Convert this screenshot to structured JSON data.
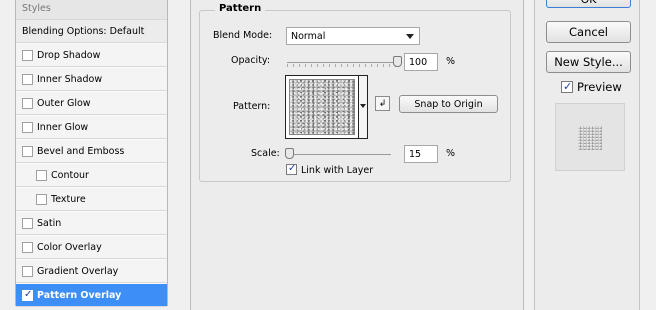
{
  "styles_panel": {
    "header": "Styles",
    "items": [
      {
        "label": "Blending Options: Default",
        "checkbox": false,
        "checked": false,
        "indent": false,
        "selected": false
      },
      {
        "label": "Drop Shadow",
        "checkbox": true,
        "checked": false,
        "indent": false,
        "selected": false
      },
      {
        "label": "Inner Shadow",
        "checkbox": true,
        "checked": false,
        "indent": false,
        "selected": false
      },
      {
        "label": "Outer Glow",
        "checkbox": true,
        "checked": false,
        "indent": false,
        "selected": false
      },
      {
        "label": "Inner Glow",
        "checkbox": true,
        "checked": false,
        "indent": false,
        "selected": false
      },
      {
        "label": "Bevel and Emboss",
        "checkbox": true,
        "checked": false,
        "indent": false,
        "selected": false
      },
      {
        "label": "Contour",
        "checkbox": true,
        "checked": false,
        "indent": true,
        "selected": false
      },
      {
        "label": "Texture",
        "checkbox": true,
        "checked": false,
        "indent": true,
        "selected": false
      },
      {
        "label": "Satin",
        "checkbox": true,
        "checked": false,
        "indent": false,
        "selected": false
      },
      {
        "label": "Color Overlay",
        "checkbox": true,
        "checked": false,
        "indent": false,
        "selected": false
      },
      {
        "label": "Gradient Overlay",
        "checkbox": true,
        "checked": false,
        "indent": false,
        "selected": false
      },
      {
        "label": "Pattern Overlay",
        "checkbox": true,
        "checked": true,
        "indent": false,
        "selected": true
      }
    ]
  },
  "pattern_group": {
    "title": "Pattern",
    "blend_mode_label": "Blend Mode:",
    "blend_mode_value": "Normal",
    "opacity_label": "Opacity:",
    "opacity_value": "100",
    "opacity_unit": "%",
    "opacity_level": 1.0,
    "pattern_label": "Pattern:",
    "snap_button": "Snap to Origin",
    "scale_label": "Scale:",
    "scale_value": "15",
    "scale_unit": "%",
    "scale_level": 0.02,
    "link_label": "Link with Layer",
    "link_checked": true
  },
  "actions": {
    "ok_label": "OK",
    "cancel_label": "Cancel",
    "new_style_label": "New Style...",
    "preview_label": "Preview",
    "preview_checked": true
  },
  "colors": {
    "selection": "#3d8ef7",
    "panel_bg": "#ececec",
    "check_mark": "#1f3f9c"
  }
}
